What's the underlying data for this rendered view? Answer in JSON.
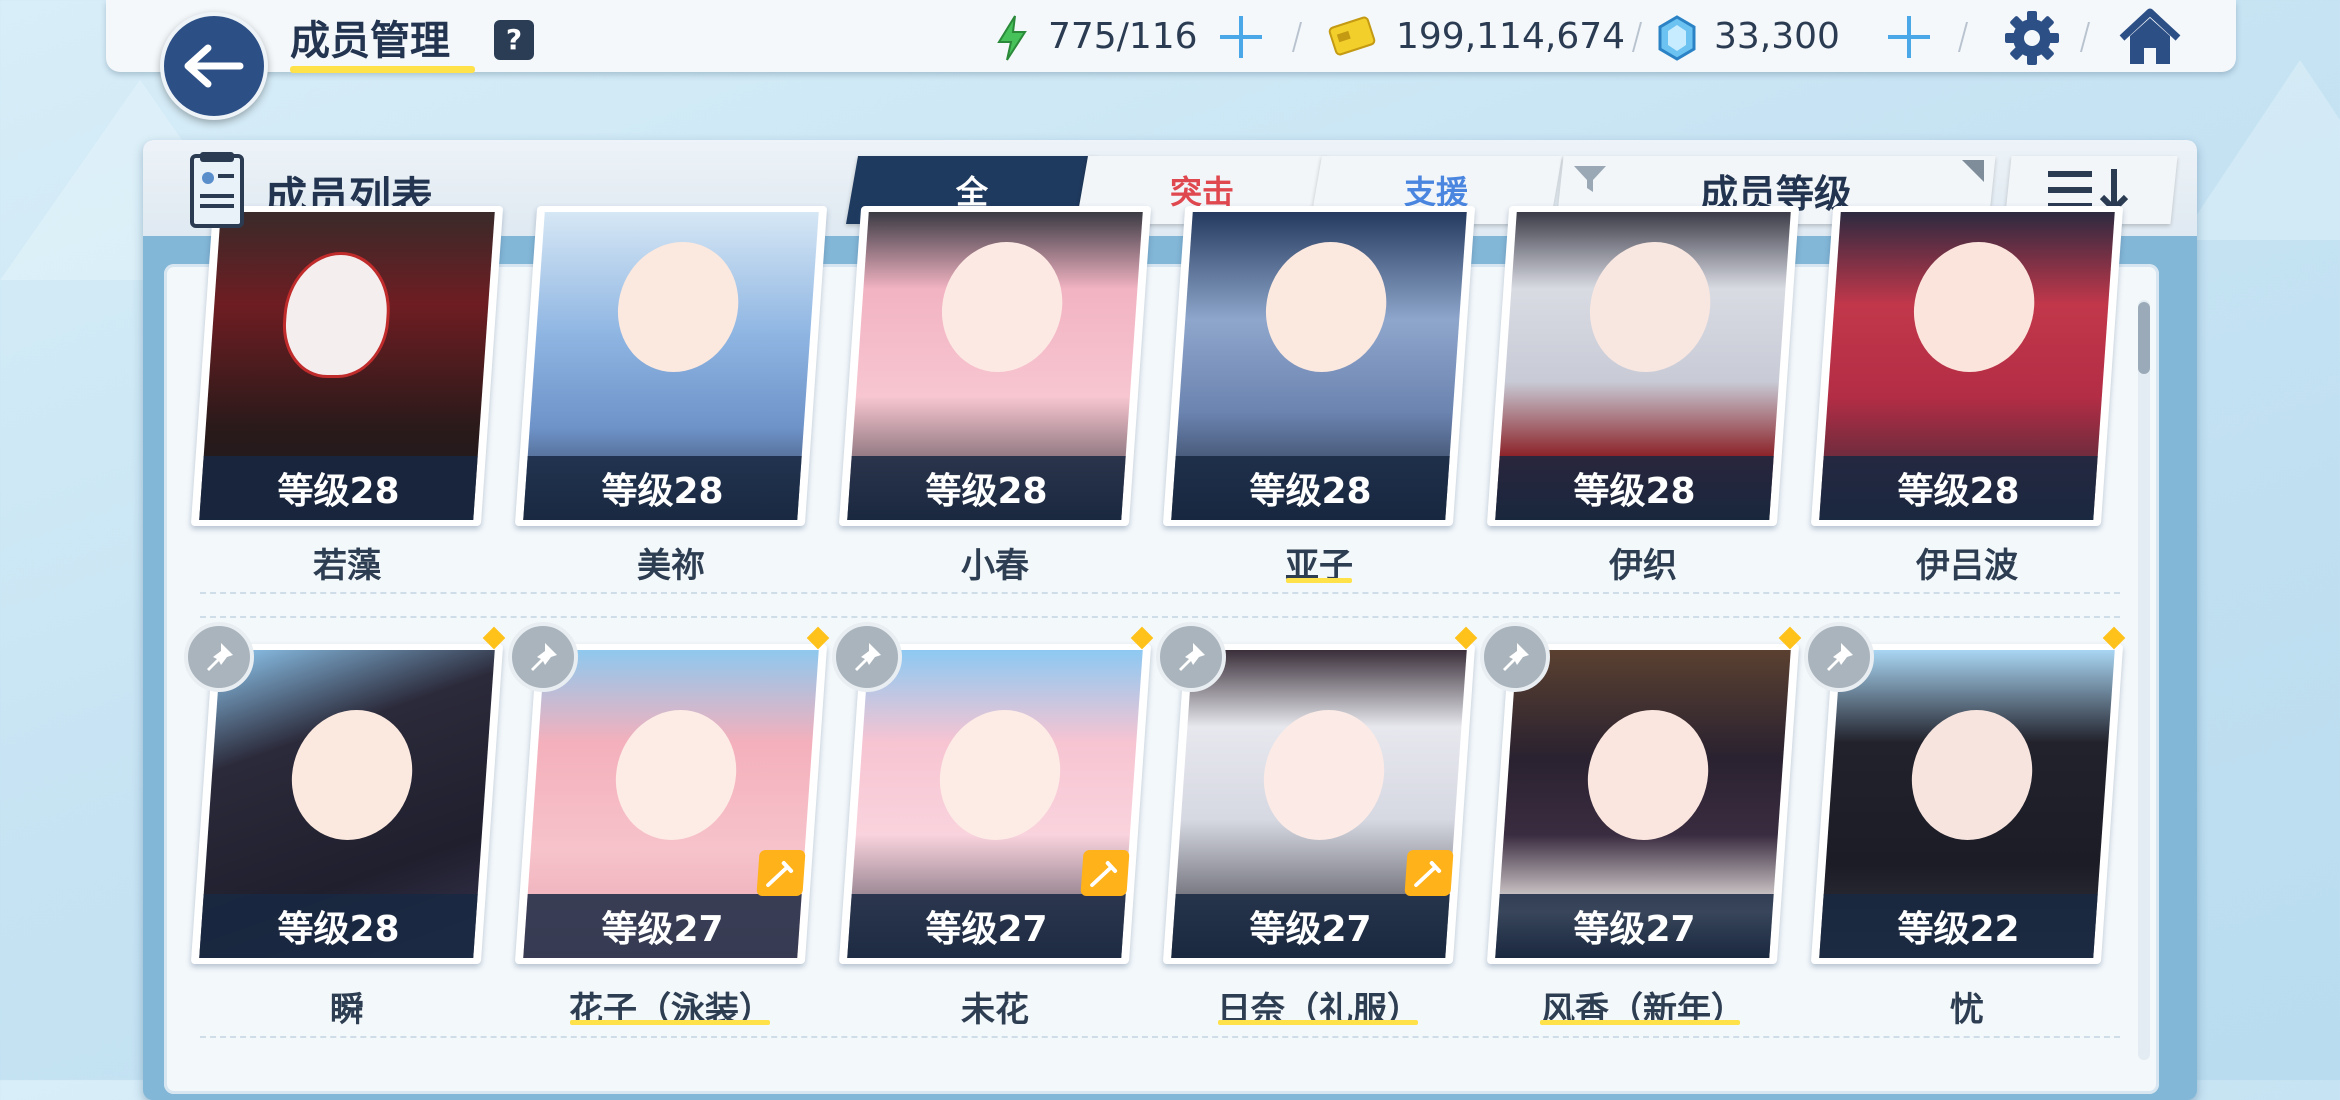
{
  "header": {
    "title": "成员管理",
    "help": "?",
    "stamina": "775/116",
    "credits": "199,114,674",
    "gems": "33,300"
  },
  "list": {
    "title": "成员列表",
    "tabs": [
      {
        "label": "全",
        "selected": true
      },
      {
        "label": "突击",
        "selected": false
      },
      {
        "label": "支援",
        "selected": false
      }
    ],
    "sort_label": "成员等级"
  },
  "members": [
    {
      "name": "若藻",
      "level": "等级28"
    },
    {
      "name": "美祢",
      "level": "等级28"
    },
    {
      "name": "小春",
      "level": "等级28"
    },
    {
      "name": "亚子",
      "level": "等级28"
    },
    {
      "name": "伊织",
      "level": "等级28"
    },
    {
      "name": "伊吕波",
      "level": "等级28"
    },
    {
      "name": "瞬",
      "level": "等级28"
    },
    {
      "name": "花子（泳装）",
      "level": "等级27"
    },
    {
      "name": "未花",
      "level": "等级27"
    },
    {
      "name": "日奈（礼服）",
      "level": "等级27"
    },
    {
      "name": "风香（新年）",
      "level": "等级27"
    },
    {
      "name": "忧",
      "level": "等级22"
    }
  ],
  "colors": {
    "primary_dark": "#1f3a5f",
    "accent_yellow": "#ffe14a",
    "assault_red": "#e0484f",
    "support_blue": "#4a86e0",
    "plus_blue": "#4aa8e8"
  }
}
